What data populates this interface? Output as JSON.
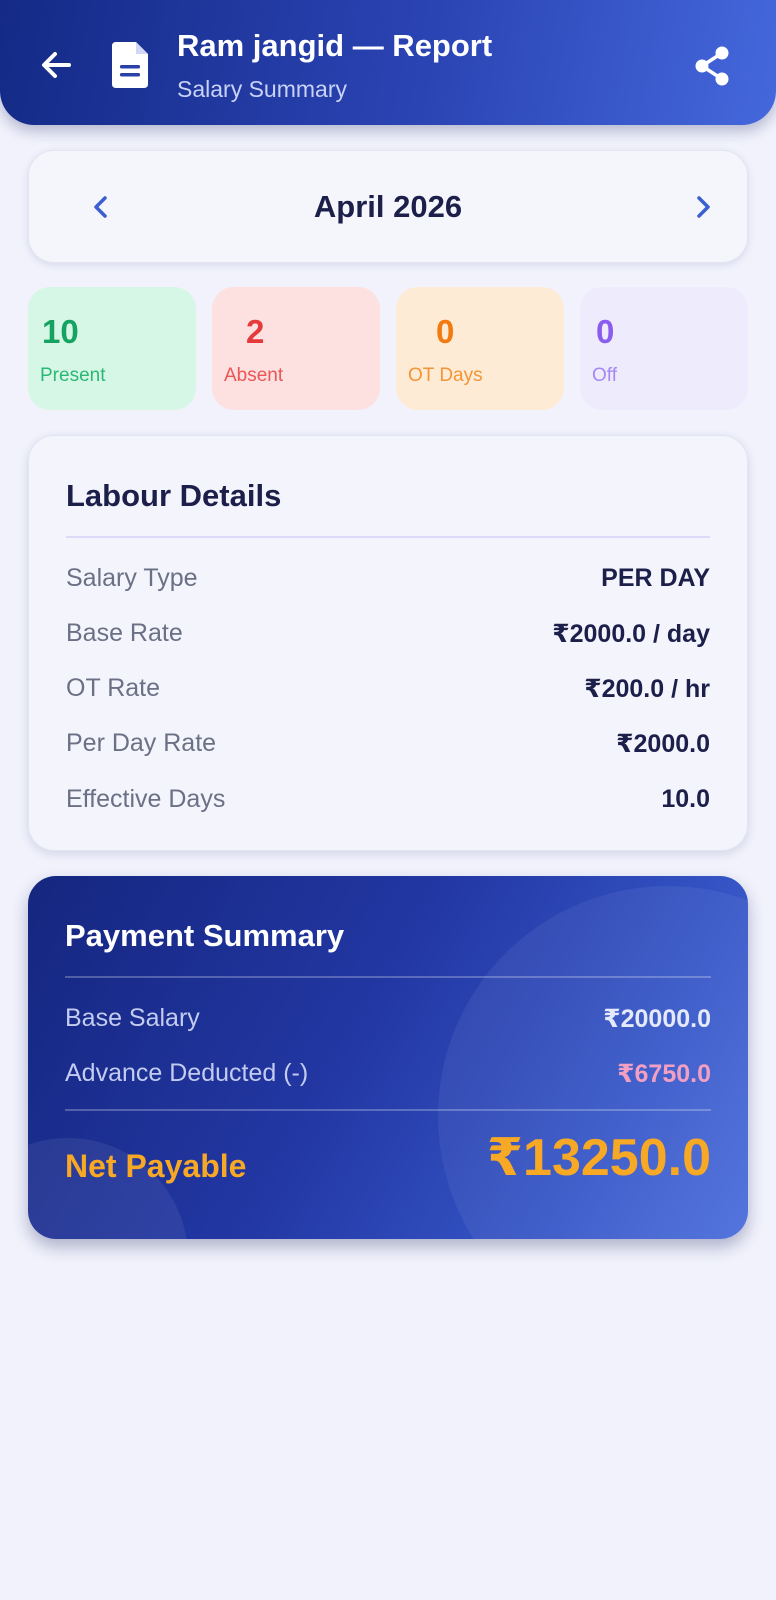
{
  "header": {
    "title": "Ram jangid — Report",
    "subtitle": "Salary Summary"
  },
  "month_selector": {
    "label": "April 2026"
  },
  "stats": [
    {
      "value": "10",
      "label": "Present"
    },
    {
      "value": "2",
      "label": "Absent"
    },
    {
      "value": "0",
      "label": "OT Days"
    },
    {
      "value": "0",
      "label": "Off"
    }
  ],
  "labour_details": {
    "title": "Labour Details",
    "rows": [
      {
        "key": "Salary Type",
        "value": "PER DAY"
      },
      {
        "key": "Base Rate",
        "value": "₹2000.0 / day"
      },
      {
        "key": "OT Rate",
        "value": "₹200.0 / hr"
      },
      {
        "key": "Per Day Rate",
        "value": "₹2000.0"
      },
      {
        "key": "Effective Days",
        "value": "10.0"
      }
    ]
  },
  "payment_summary": {
    "title": "Payment Summary",
    "base_salary_label": "Base Salary",
    "base_salary_value": "₹20000.0",
    "advance_label": "Advance Deducted (-)",
    "advance_value": "₹6750.0",
    "net_label": "Net Payable",
    "net_value": "₹13250.0"
  },
  "colors": {
    "header_gradient_start": "#142a86",
    "header_gradient_end": "#4468dc",
    "present": "#16a362",
    "absent": "#e53a3a",
    "ot": "#f27a0f",
    "off": "#8a5cf0",
    "net_payable": "#f7a825",
    "advance": "#f29fc4"
  },
  "icons": {
    "back": "arrow-left-icon",
    "document": "document-icon",
    "share": "share-icon",
    "prev": "chevron-left-icon",
    "next": "chevron-right-icon"
  }
}
